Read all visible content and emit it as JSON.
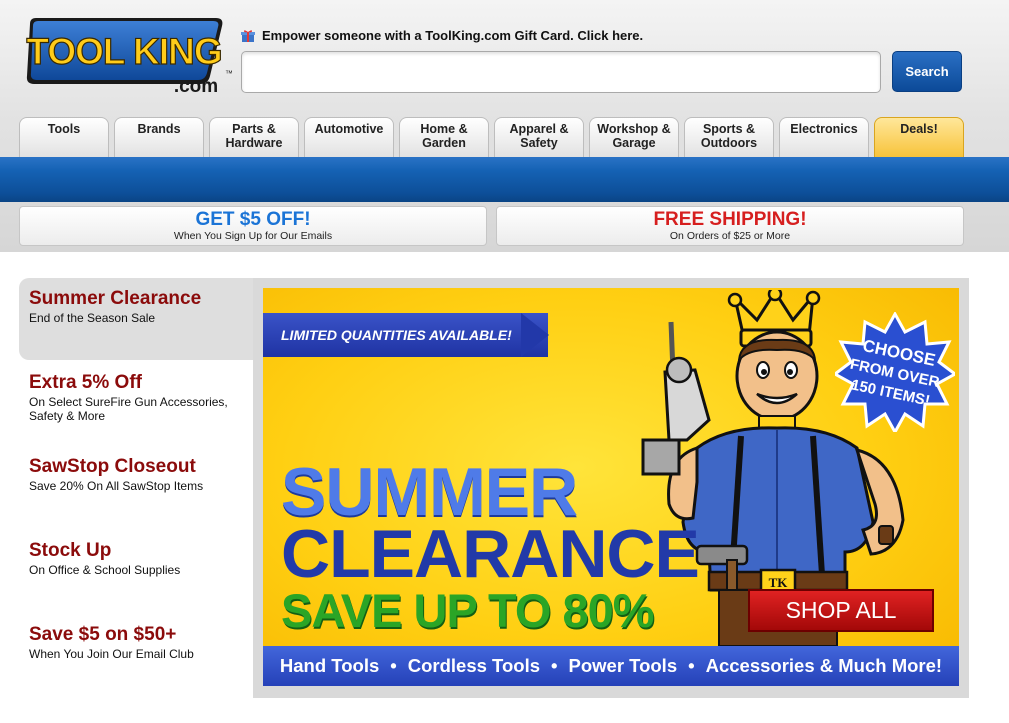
{
  "header": {
    "logo_text": "TOOL KING",
    "logo_sub": ".com",
    "logo_tm": "™",
    "gift_text": "Empower someone with a ToolKing.com Gift Card. Click here.",
    "search_value": "",
    "search_button": "Search"
  },
  "nav": {
    "tabs": [
      {
        "line1": "Tools",
        "line2": ""
      },
      {
        "line1": "Brands",
        "line2": ""
      },
      {
        "line1": "Parts &",
        "line2": "Hardware"
      },
      {
        "line1": "Automotive",
        "line2": ""
      },
      {
        "line1": "Home &",
        "line2": "Garden"
      },
      {
        "line1": "Apparel &",
        "line2": "Safety"
      },
      {
        "line1": "Workshop &",
        "line2": "Garage"
      },
      {
        "line1": "Sports &",
        "line2": "Outdoors"
      },
      {
        "line1": "Electronics",
        "line2": ""
      },
      {
        "line1": "Deals!",
        "line2": ""
      }
    ]
  },
  "promos": {
    "left": {
      "title": "GET $5 OFF!",
      "sub": "When You Sign Up for Our Emails",
      "color": "#1b74d6"
    },
    "right": {
      "title": "FREE SHIPPING!",
      "sub": "On Orders of $25 or More",
      "color": "#d61f1f"
    }
  },
  "sidebar": {
    "items": [
      {
        "title": "Summer Clearance",
        "sub": "End of the Season Sale"
      },
      {
        "title": "Extra 5% Off",
        "sub": "On Select SureFire Gun Accessories,",
        "sub2": "Safety & More"
      },
      {
        "title": "SawStop Closeout",
        "sub": "Save 20% On All SawStop Items"
      },
      {
        "title": "Stock Up",
        "sub": "On Office & School Supplies"
      },
      {
        "title": "Save $5 on $50+",
        "sub": "When You Join Our Email Club"
      }
    ]
  },
  "banner": {
    "ribbon": "LIMITED QUANTITIES AVAILABLE!",
    "headline1": "SUMMER",
    "headline2": "CLEARANCE",
    "save": "SAVE UP TO 80%",
    "shop_all": "SHOP ALL",
    "burst_line1": "CHOOSE",
    "burst_line2": "FROM OVER",
    "burst_line3": "150 ITEMS!",
    "belt_logo": "TK",
    "bottom_items": [
      "Hand Tools",
      "Cordless Tools",
      "Power Tools",
      "Accessories & Much More!"
    ]
  },
  "colors": {
    "accent_blue": "#0c4a98",
    "sidebar_title": "#8b0b0b",
    "banner_yellow": "#ffcf12"
  }
}
